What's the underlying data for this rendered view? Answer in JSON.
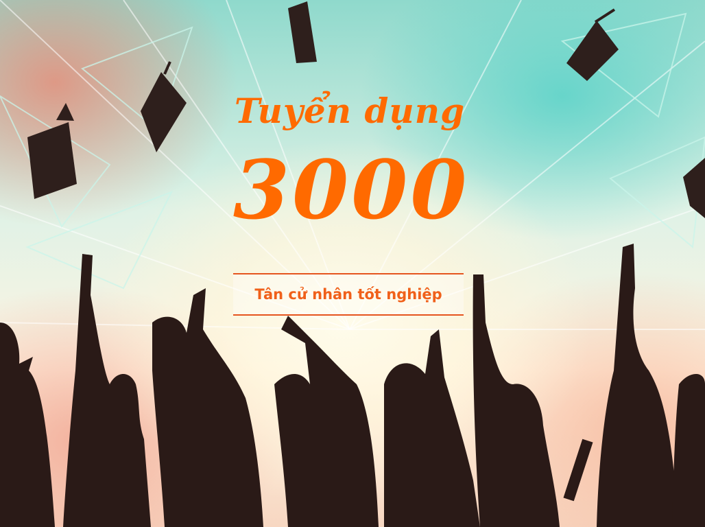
{
  "banner": {
    "title": "Tuyển dụng",
    "number": "3000",
    "subtitle": "Tân cử nhân tốt nghiệp"
  },
  "colors": {
    "accent": "#ff6a00",
    "rule": "#e5541e",
    "silhouette": "#2a1a17",
    "teal": "#8fd9cc",
    "coral": "#f0a08c"
  },
  "icons": [
    "graduation-cap-icon"
  ]
}
